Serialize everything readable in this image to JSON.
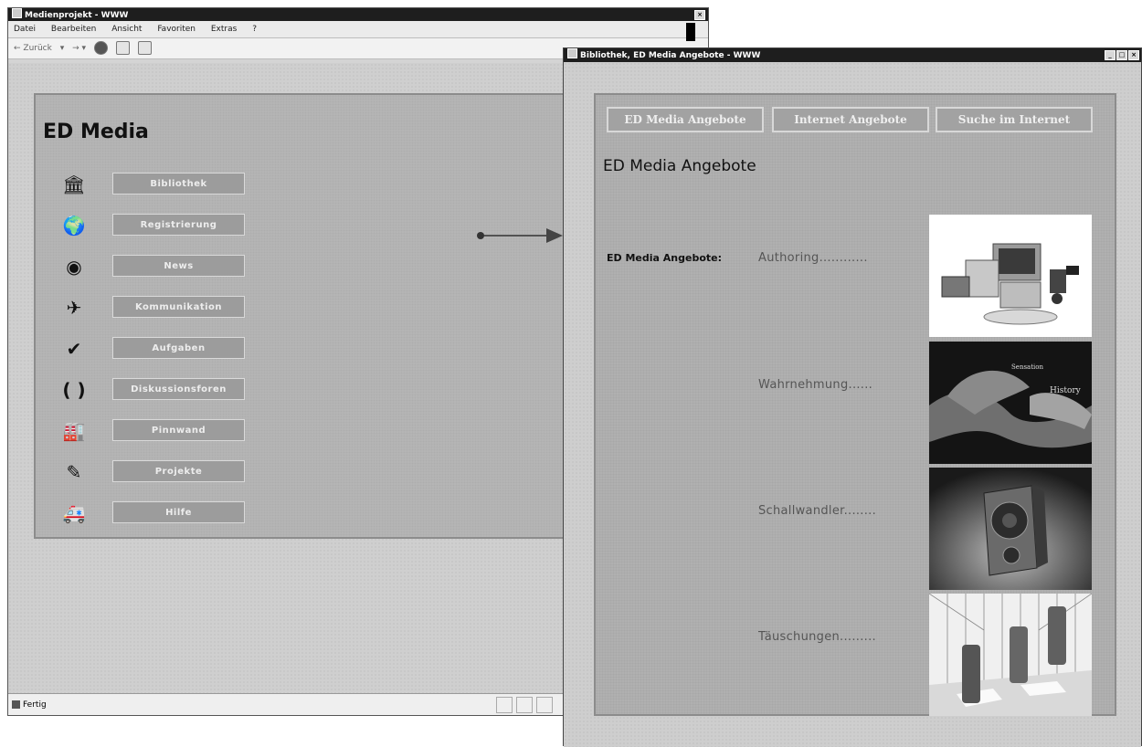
{
  "main_window": {
    "title": "Medienprojekt - WWW",
    "menu": [
      "Datei",
      "Bearbeiten",
      "Ansicht",
      "Favoriten",
      "Extras",
      "?"
    ],
    "toolbar": {
      "back_label": "← Zurück",
      "status_text": "Fertig"
    },
    "brand": "ED Media",
    "nav": [
      {
        "label": "Bibliothek",
        "icon": "library-icon"
      },
      {
        "label": "Registrierung",
        "icon": "globe-icon"
      },
      {
        "label": "News",
        "icon": "eye-icon"
      },
      {
        "label": "Kommunikation",
        "icon": "bird-icon"
      },
      {
        "label": "Aufgaben",
        "icon": "checkmark-icon"
      },
      {
        "label": "Diskussionsforen",
        "icon": "parentheses-icon"
      },
      {
        "label": "Pinnwand",
        "icon": "factory-icon"
      },
      {
        "label": "Projekte",
        "icon": "pen-icon"
      },
      {
        "label": "Hilfe",
        "icon": "ambulance-icon"
      }
    ]
  },
  "popup_window": {
    "title": "Bibliothek, ED Media Angebote - WWW",
    "tabs": [
      "ED Media Angebote",
      "Internet Angebote",
      "Suche im Internet"
    ],
    "heading": "ED Media Angebote",
    "offers_label": "ED Media Angebote:",
    "offers": [
      {
        "label": "Authoring............",
        "image": "computer-equipment-image"
      },
      {
        "label": "Wahrnehmung......",
        "image": "hands-sculpture-image"
      },
      {
        "label": "Schallwandler........",
        "image": "speaker-image"
      },
      {
        "label": "Täuschungen.........",
        "image": "pillars-room-image"
      }
    ]
  }
}
